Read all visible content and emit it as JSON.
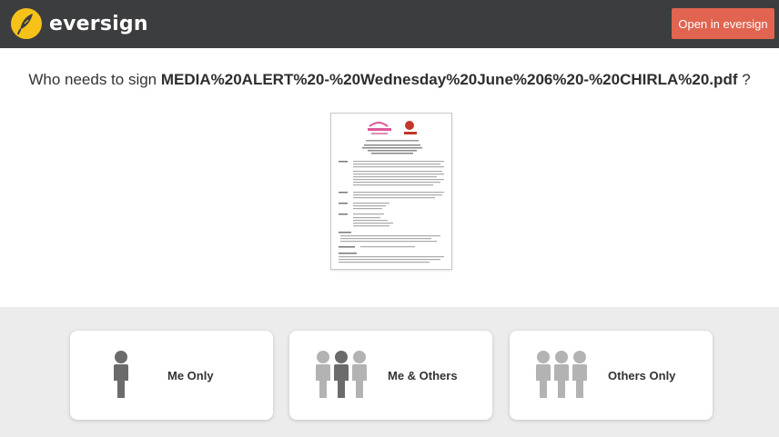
{
  "header": {
    "brand": "eversign",
    "open_button": "Open in eversign"
  },
  "prompt": {
    "prefix": "Who needs to sign ",
    "filename": "MEDIA%20ALERT%20-%20Wednesday%20June%206%20-%20CHIRLA%20.pdf",
    "suffix": " ?"
  },
  "options": {
    "me_only": "Me Only",
    "me_and_others": "Me & Others",
    "others_only": "Others Only"
  },
  "colors": {
    "topbar": "#3c3d3f",
    "accent": "#e0644f",
    "logo": "#f6c21a",
    "person_dark": "#6b6b6b",
    "person_light": "#b3b3b3"
  }
}
